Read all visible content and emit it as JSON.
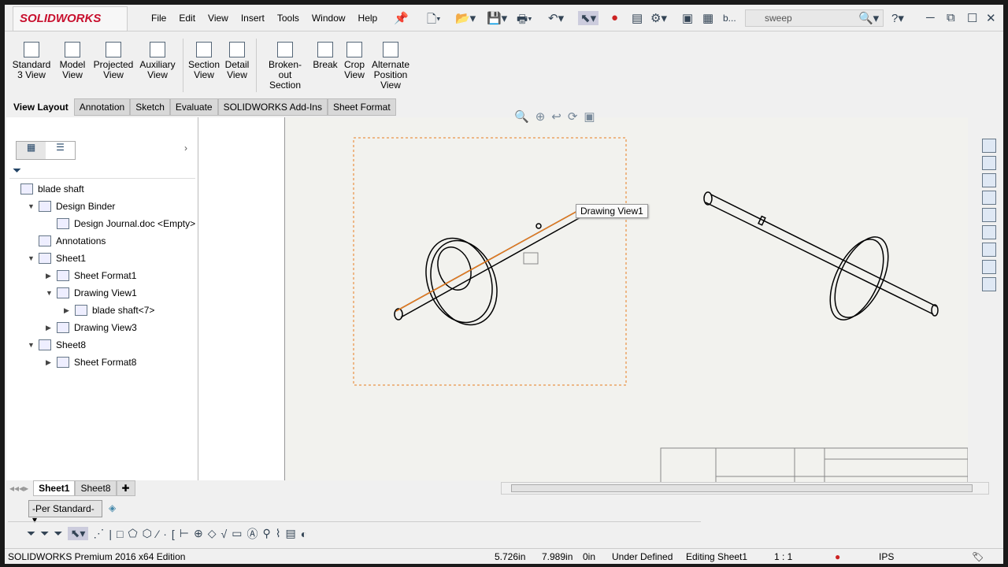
{
  "app": {
    "logo": "SOLIDWORKS",
    "search_placeholder": "sweep",
    "titlebar_doc": "b..."
  },
  "menu": [
    "File",
    "Edit",
    "View",
    "Insert",
    "Tools",
    "Window",
    "Help"
  ],
  "ribbon": [
    {
      "label": "Standard 3 View"
    },
    {
      "label": "Model View"
    },
    {
      "label": "Projected View"
    },
    {
      "label": "Auxiliary View"
    },
    {
      "label": "Section View"
    },
    {
      "label": "Detail View"
    },
    {
      "label": "Broken-out Section"
    },
    {
      "label": "Break"
    },
    {
      "label": "Crop View"
    },
    {
      "label": "Alternate Position View"
    }
  ],
  "tabs": [
    "View Layout",
    "Annotation",
    "Sketch",
    "Evaluate",
    "SOLIDWORKS Add-Ins",
    "Sheet Format"
  ],
  "tree": [
    {
      "label": "blade shaft",
      "level": 0,
      "expander": ""
    },
    {
      "label": "Design Binder",
      "level": 1,
      "expander": "▼"
    },
    {
      "label": "Design Journal.doc <Empty>",
      "level": 2,
      "expander": ""
    },
    {
      "label": "Annotations",
      "level": 1,
      "expander": ""
    },
    {
      "label": "Sheet1",
      "level": 1,
      "expander": "▼"
    },
    {
      "label": "Sheet Format1",
      "level": 2,
      "expander": "▶"
    },
    {
      "label": "Drawing View1",
      "level": 2,
      "expander": "▼"
    },
    {
      "label": "blade shaft<7>",
      "level": 3,
      "expander": "▶"
    },
    {
      "label": "Drawing View3",
      "level": 2,
      "expander": "▶"
    },
    {
      "label": "Sheet8",
      "level": 1,
      "expander": "▼"
    },
    {
      "label": "Sheet Format8",
      "level": 2,
      "expander": "▶"
    }
  ],
  "canvas": {
    "tooltip": "Drawing View1",
    "accent": "#e87c1e"
  },
  "sheet_tabs": [
    "Sheet1",
    "Sheet8"
  ],
  "layer": "-Per Standard-",
  "status": {
    "edition": "SOLIDWORKS Premium 2016 x64 Edition",
    "x": "5.726in",
    "y": "7.989in",
    "z": "0in",
    "state": "Under Defined",
    "editing": "Editing Sheet1",
    "scale": "1 : 1",
    "units": "IPS"
  }
}
